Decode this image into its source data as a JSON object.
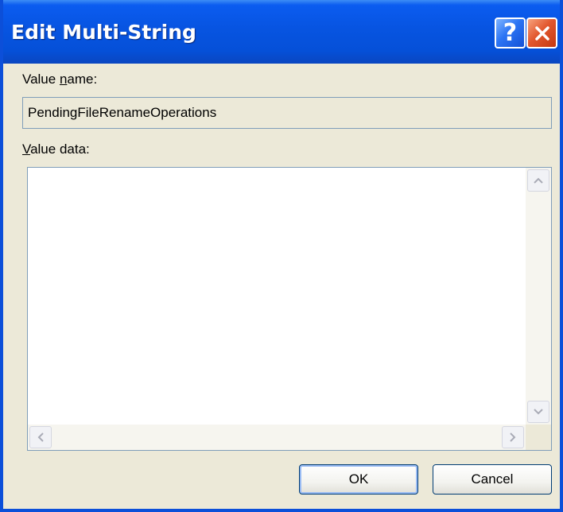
{
  "window": {
    "title": "Edit Multi-String",
    "help_label": "?"
  },
  "value_name": {
    "label_prefix": "Value ",
    "label_mnemonic": "n",
    "label_suffix": "ame:",
    "value": "PendingFileRenameOperations"
  },
  "value_data": {
    "label_mnemonic": "V",
    "label_suffix": "alue data:",
    "value": ""
  },
  "buttons": {
    "ok": "OK",
    "cancel": "Cancel"
  },
  "icons": {
    "help": "help-icon",
    "close": "close-icon",
    "scroll_up": "arrow-up-icon",
    "scroll_down": "arrow-down-icon",
    "scroll_left": "arrow-left-icon",
    "scroll_right": "arrow-right-icon"
  },
  "colors": {
    "titlebar": "#0754e1",
    "dialog_bg": "#ece9d8",
    "close_button": "#e2582f",
    "field_border": "#7f9db9"
  }
}
